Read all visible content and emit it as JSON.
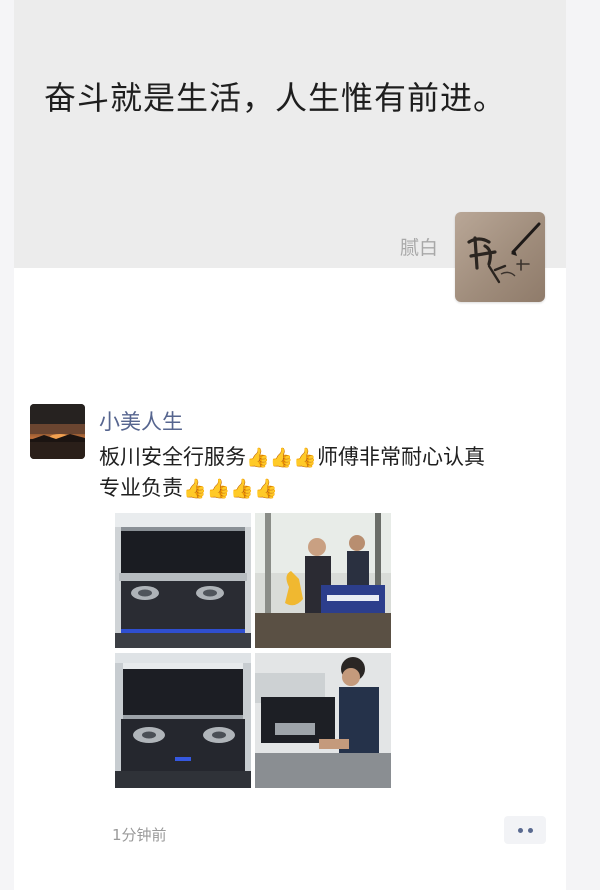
{
  "profile": {
    "signature": "奋斗就是生活，人生惟有前进。",
    "nickname": "腻白",
    "avatar_icon": "calligraphy-pen-avatar"
  },
  "post": {
    "author": "小美人生",
    "text_line1_prefix": "板川安全行服务",
    "text_line1_suffix": "师傅非常耐心认真",
    "text_line2_prefix": "专业负责",
    "emoji": "👍",
    "emoji_count_line1": 3,
    "emoji_count_line2": 4,
    "photos": [
      {
        "name": "range-hood-stove-photo-1"
      },
      {
        "name": "technicians-with-banner-photo"
      },
      {
        "name": "range-hood-stove-photo-2"
      },
      {
        "name": "technician-cleaning-photo"
      }
    ],
    "banner_text": "安全行服务",
    "timestamp": "1分钟前",
    "more_icon": "more-dots-icon"
  },
  "colors": {
    "cover_bg": "#ececec",
    "author_link": "#56658f",
    "timestamp": "#9a9a9a"
  }
}
